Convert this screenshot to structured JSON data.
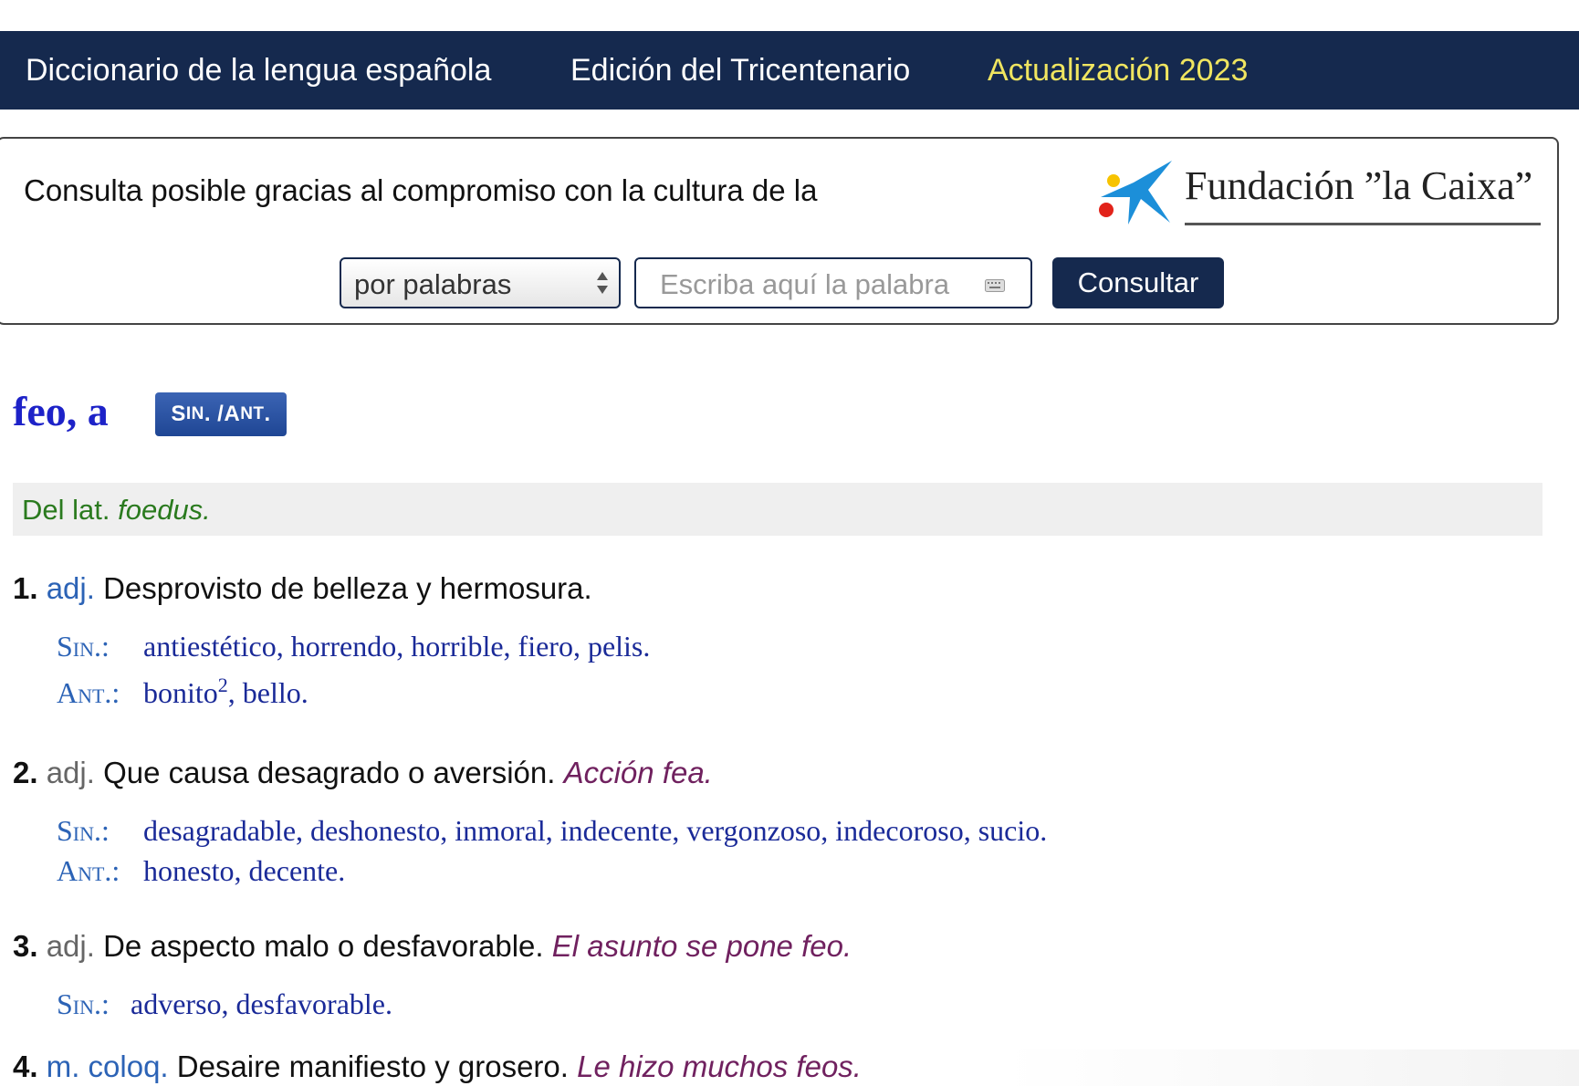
{
  "nav": {
    "items": [
      {
        "label": "Diccionario de la lengua española"
      },
      {
        "label": "Edición del Tricentenario"
      },
      {
        "label": "Actualización 2023"
      }
    ]
  },
  "sponsor": {
    "text": "Consulta posible gracias al compromiso con la cultura de la",
    "logo_text": "Fundación ”la Caixa”"
  },
  "search": {
    "mode": "por palabras",
    "placeholder": "Escriba aquí la palabra",
    "button": "Consultar"
  },
  "entry": {
    "headword": "feo, a",
    "sinant_button": {
      "s": "S",
      "in": "IN",
      "sep": ". / ",
      "a": "A",
      "nt": "NT",
      "end": "."
    },
    "etymology": {
      "prefix": "Del lat. ",
      "word": "foedus."
    },
    "senses": [
      {
        "num": "1.",
        "abbr": "adj.",
        "def": "Desprovisto de belleza y hermosura.",
        "example": "",
        "syn_label": "Sin.:",
        "syn": "antiestético, horrendo, horrible, fiero, pelis.",
        "ant_label": "Ant.:",
        "ant_pre": "bonito",
        "ant_sup": "2",
        "ant_post": ", bello."
      },
      {
        "num": "2.",
        "abbr": "adj.",
        "def": "Que causa desagrado o aversión.",
        "example": "Acción fea.",
        "syn_label": "Sin.:",
        "syn": "desagradable, deshonesto, inmoral, indecente, vergonzoso, indecoroso, sucio.",
        "ant_label": "Ant.:",
        "ant": "honesto, decente."
      },
      {
        "num": "3.",
        "abbr": "adj.",
        "def": "De aspecto malo o desfavorable.",
        "example": "El asunto se pone feo.",
        "syn_label": "Sin.:",
        "syn": "adverso, desfavorable."
      },
      {
        "num": "4.",
        "abbr": "m. coloq.",
        "def": "Desaire manifiesto y grosero.",
        "example": "Le hizo muchos feos."
      }
    ]
  },
  "colors": {
    "navbar": "#15294e",
    "nav_current": "#f0e560",
    "headword": "#1d22c8",
    "abbr": "#2c63b6",
    "example": "#70215f",
    "synonyms": "#1a2a98",
    "etymology": "#2a7a1e"
  },
  "icons": {
    "select_arrows": "select-arrows-icon",
    "keyboard": "keyboard-icon",
    "logo_star": "la-caixa-star-logo"
  }
}
